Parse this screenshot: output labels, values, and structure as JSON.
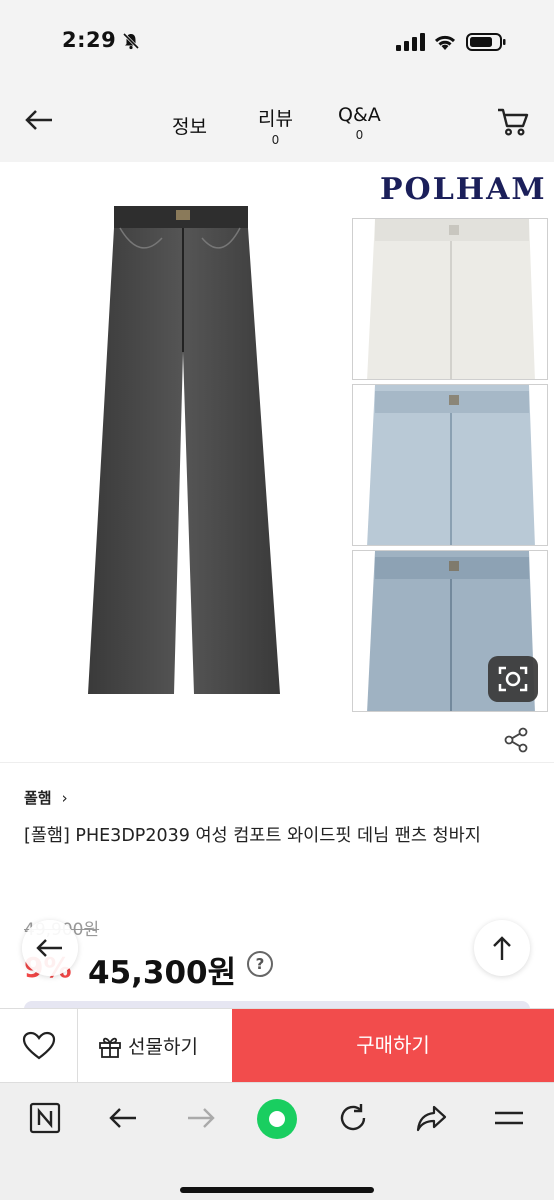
{
  "status": {
    "time": "2:29"
  },
  "header": {
    "tabs": [
      {
        "label": "정보",
        "count": ""
      },
      {
        "label": "리뷰",
        "count": "0"
      },
      {
        "label": "Q&A",
        "count": "0"
      }
    ]
  },
  "gallery": {
    "brand_logo": "POLHAM"
  },
  "product": {
    "brand": "폴햄",
    "title": "[폴햄] PHE3DP2039 여성 컴포트 와이드핏 데님 팬츠 청바지",
    "original_price": "49,900원",
    "discount": "9%",
    "price": "45,300원",
    "help": "?"
  },
  "actions": {
    "gift_label": "선물하기",
    "buy_label": "구매하기"
  },
  "colors": {
    "accent": "#f24c4c",
    "brand": "#1b1f5a"
  }
}
